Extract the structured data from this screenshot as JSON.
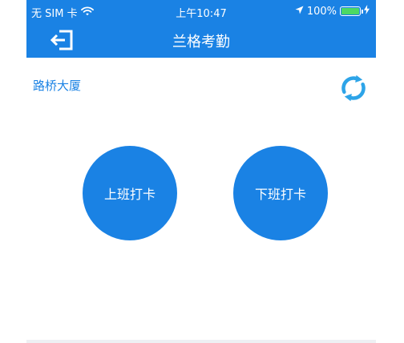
{
  "status_bar": {
    "carrier": "无 SIM 卡",
    "time": "上午10:47",
    "battery_percent": "100%",
    "battery_level": 1.0,
    "icons": [
      "wifi-icon",
      "location-arrow-icon",
      "battery-icon",
      "charging-bolt-icon"
    ]
  },
  "nav": {
    "title": "兰格考勤",
    "left_icon": "logout-icon"
  },
  "main": {
    "location": "路桥大厦",
    "refresh_icon": "refresh-icon",
    "punch_in_label": "上班打卡",
    "punch_out_label": "下班打卡"
  },
  "colors": {
    "primary": "#1a82e4",
    "refresh": "#2da4e8",
    "battery_fill": "#4cd964",
    "background": "#ffffff"
  }
}
